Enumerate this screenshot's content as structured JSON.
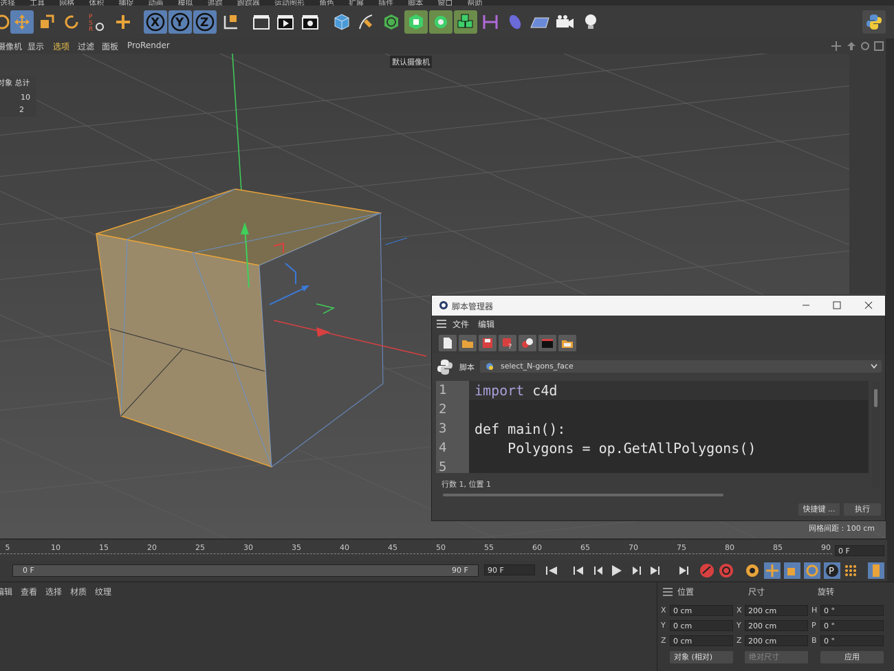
{
  "top_menu": [
    "选择",
    "工具",
    "网格",
    "体积",
    "捕捉",
    "动画",
    "模拟",
    "追踪",
    "跟踪器",
    "运动图形",
    "角色",
    "扩展",
    "插件",
    "脚本",
    "窗口",
    "帮助"
  ],
  "viewport_menu": {
    "items": [
      "摄像机",
      "显示",
      "选项",
      "过滤",
      "面板",
      "ProRender"
    ]
  },
  "viewport": {
    "camera_label": "默认摄像机",
    "stats": {
      "header": "对象 总计",
      "row1": "10",
      "row2": "2"
    },
    "grid_spacing": "网格间距 : 100 cm"
  },
  "script_manager": {
    "title": "脚本管理器",
    "menu": [
      "文件",
      "编辑"
    ],
    "script_label": "脚本",
    "script_name": "select_N-gons_face",
    "line_numbers": [
      "1",
      "2",
      "3",
      "4",
      "5"
    ],
    "code": {
      "l1_kw": "import",
      "l1_rest": " c4d",
      "l3_kw": "def",
      "l3_rest": " main():",
      "l4": "    Polygons = op.GetAllPolygons()"
    },
    "status": "行数 1, 位置 1",
    "shortcut_button": "快捷键 ...",
    "execute_button": "执行"
  },
  "timeline": {
    "ticks": [
      "5",
      "10",
      "15",
      "20",
      "25",
      "30",
      "35",
      "40",
      "45",
      "50",
      "55",
      "60",
      "65",
      "70",
      "75",
      "80",
      "85",
      "90"
    ],
    "current_frame": "0 F",
    "range_start": "0 F",
    "range_end": "90 F",
    "end_field": "90 F"
  },
  "materials_menu": [
    "编辑",
    "查看",
    "选择",
    "材质",
    "纹理"
  ],
  "coordinates": {
    "headers": {
      "position": "位置",
      "size": "尺寸",
      "rotation": "旋转"
    },
    "rows": [
      {
        "axis": "X",
        "pos": "0 cm",
        "saxis": "X",
        "size": "200 cm",
        "raxis": "H",
        "rot": "0 °"
      },
      {
        "axis": "Y",
        "pos": "0 cm",
        "saxis": "Y",
        "size": "200 cm",
        "raxis": "P",
        "rot": "0 °"
      },
      {
        "axis": "Z",
        "pos": "0 cm",
        "saxis": "Z",
        "size": "200 cm",
        "raxis": "B",
        "rot": "0 °"
      }
    ],
    "mode_select": "对象 (相对)",
    "size_select": "绝对尺寸",
    "apply_button": "应用"
  },
  "colors": {
    "accent_orange": "#e8a33a",
    "selection_blue": "#5a7fb3",
    "face_fill": "#8a7a5a"
  }
}
